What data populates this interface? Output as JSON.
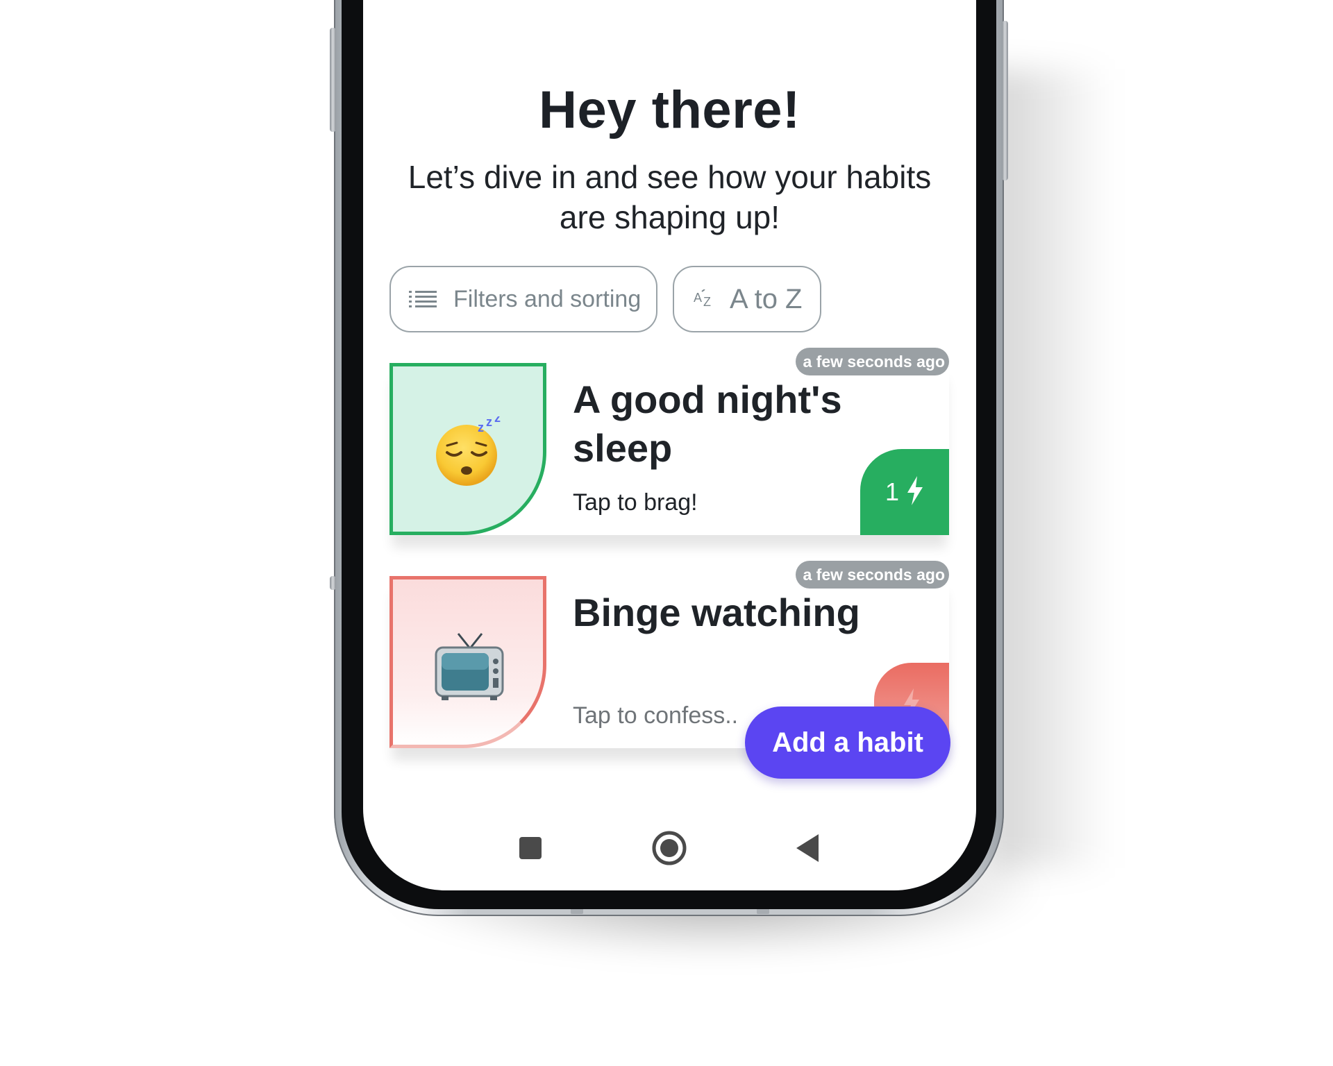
{
  "header": {
    "title": "Hey there!",
    "subtitle": "Let’s dive in and see how your habits are shaping up!"
  },
  "controls": {
    "filters_label": "Filters and sorting",
    "filters_icon": "list-icon",
    "sort_label": "A to Z",
    "sort_icon": "sort-alpha-icon",
    "sort_icon_glyph": "AZ"
  },
  "habits": [
    {
      "name": "A good night's sleep",
      "hint": "Tap to brag!",
      "timestamp": "a few seconds ago",
      "streak_count": "1",
      "emoji": "sleeping-face-icon",
      "type": "good",
      "accent": "#27ae60",
      "thumb_bg": "#d5f2e6"
    },
    {
      "name": "Binge watching",
      "hint": "Tap to confess..",
      "timestamp": "a few seconds ago",
      "streak_count": "",
      "emoji": "television-icon",
      "type": "bad",
      "accent": "#e8736b",
      "thumb_bg": "#fbdcdc"
    }
  ],
  "fab": {
    "label": "Add a habit",
    "color": "#5b45f2"
  },
  "navbar": {
    "items": [
      "recents-icon",
      "home-icon",
      "back-icon"
    ]
  }
}
